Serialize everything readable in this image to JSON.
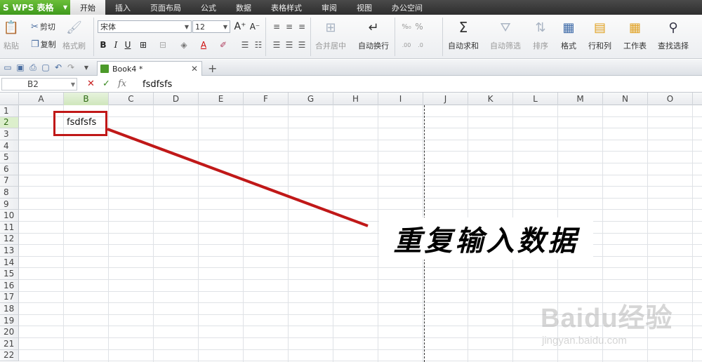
{
  "app": {
    "logo": "S",
    "name": "WPS 表格"
  },
  "menu": {
    "tabs": [
      "开始",
      "插入",
      "页面布局",
      "公式",
      "数据",
      "表格样式",
      "审阅",
      "视图",
      "办公空间"
    ],
    "active_index": 0
  },
  "ribbon": {
    "paste": "粘贴",
    "cut": "剪切",
    "copy": "复制",
    "format_painter": "格式刷",
    "font_name": "宋体",
    "font_size": "12",
    "merge_center": "合并居中",
    "wrap_text": "自动换行",
    "percent": "%",
    "autosum": "自动求和",
    "autofilter": "自动筛选",
    "sort": "排序",
    "format": "格式",
    "row_col": "行和列",
    "worksheet": "工作表",
    "find_select": "查找选择"
  },
  "document": {
    "tab_name": "Book4 *"
  },
  "formula_bar": {
    "name_box": "B2",
    "fx": "fx",
    "value": "fsdfsfs"
  },
  "sheet": {
    "columns": [
      "A",
      "B",
      "C",
      "D",
      "E",
      "F",
      "G",
      "H",
      "I",
      "J",
      "K",
      "L",
      "M",
      "N",
      "O"
    ],
    "rows": [
      "1",
      "2",
      "3",
      "4",
      "5",
      "6",
      "7",
      "8",
      "9",
      "10",
      "11",
      "12",
      "13",
      "14",
      "15",
      "16",
      "17",
      "18",
      "19",
      "20",
      "21",
      "22"
    ],
    "selected_cell": "B2",
    "cell_b2": "fsdfsfs"
  },
  "annotation": {
    "callout": "重复输入数据",
    "color": "#c01818"
  },
  "watermark": {
    "brand": "Baidu经验",
    "url": "jingyan.baidu.com"
  }
}
